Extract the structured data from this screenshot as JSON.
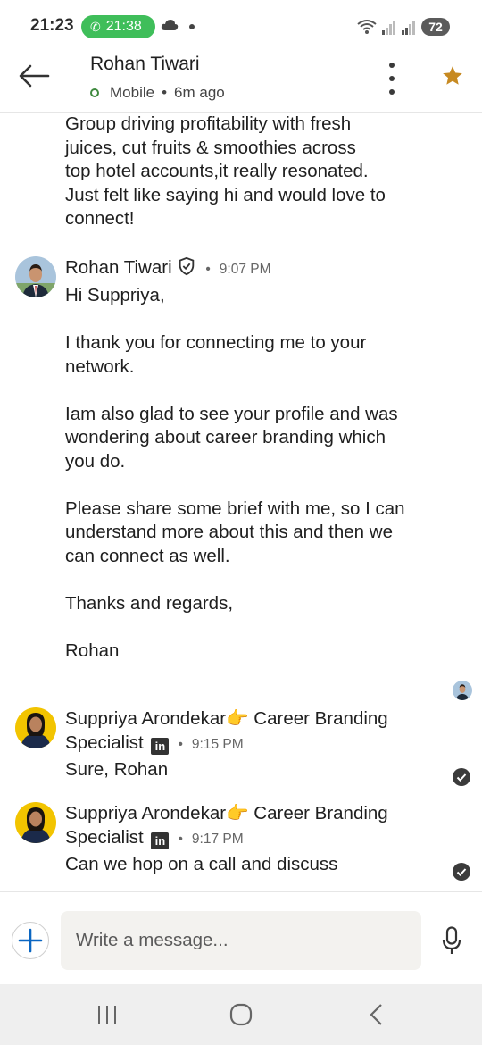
{
  "status_bar": {
    "time": "21:23",
    "call_time": "21:38",
    "battery": "72"
  },
  "header": {
    "contact_name": "Rohan Tiwari",
    "presence": "Mobile",
    "last_seen": "6m ago"
  },
  "previous_message": {
    "text": "Group driving profitability with fresh\njuices, cut fruits & smoothies across\ntop hotel accounts,it really resonated.\nJust felt like saying hi and would love to\nconnect!"
  },
  "messages": [
    {
      "sender": "Rohan Tiwari",
      "time": "9:07 PM",
      "text": "Hi Suppriya,\n\nI thank you for connecting me to your\nnetwork.\n\nIam also glad to see your profile and was\nwondering about career branding which\nyou do.\n\nPlease share some brief with me, so I can\nunderstand more about this and then we\ncan connect as well.\n\nThanks and regards,\n\nRohan"
    },
    {
      "sender_name": "Suppriya Arondekar",
      "sender_emoji": "👉",
      "sender_title_1": " Career Branding",
      "sender_title_2": "Specialist",
      "li_badge": "in",
      "time": "9:15 PM",
      "text": "Sure, Rohan"
    },
    {
      "sender_name": "Suppriya Arondekar",
      "sender_emoji": "👉",
      "sender_title_1": " Career Branding",
      "sender_title_2": "Specialist",
      "li_badge": "in",
      "time": "9:17 PM",
      "text": "Can we hop on a call and discuss"
    }
  ],
  "composer": {
    "placeholder": "Write a message..."
  },
  "colors": {
    "call_green": "#3fbe5a",
    "star": "#c78a22",
    "input_bg": "#f3f2ef",
    "nav_bg": "#efefef"
  }
}
